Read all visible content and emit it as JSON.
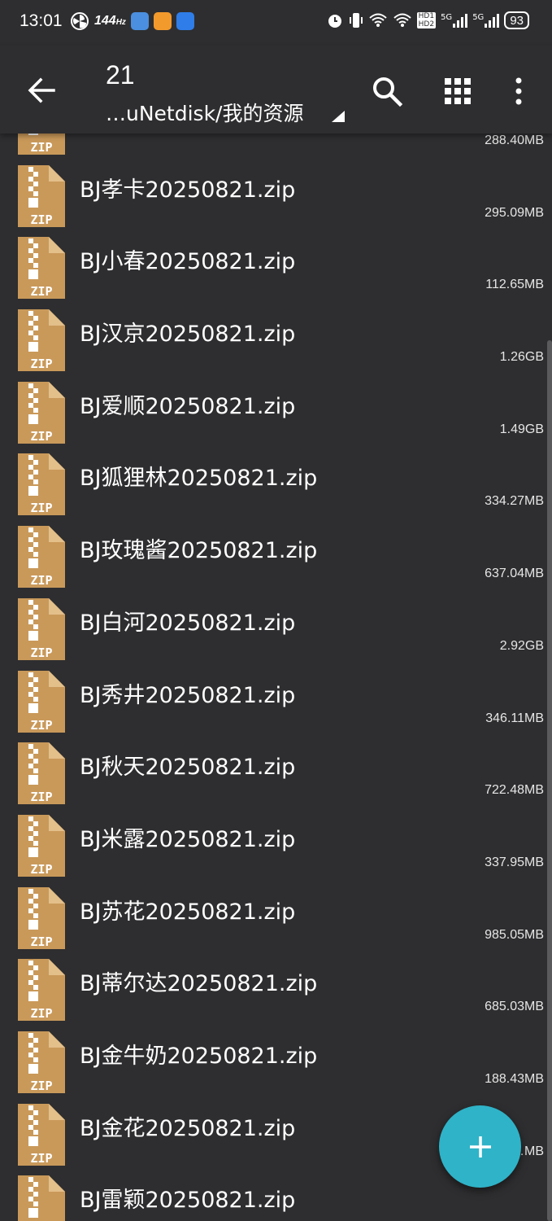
{
  "status_bar": {
    "time": "13:01",
    "refresh_rate": "144",
    "refresh_unit": "Hz",
    "battery": "93",
    "network": "5G",
    "hd1": "HD1",
    "hd2": "HD2"
  },
  "app_bar": {
    "title": "21",
    "subtitle": "…uNetdisk/我的资源",
    "back_icon": "arrow-left",
    "search_icon": "magnifier",
    "grid_icon": "grid-view",
    "more_icon": "vertical-dots"
  },
  "files": [
    {
      "name": "",
      "size": "288.40MB"
    },
    {
      "name": "BJ孝卡20250821.zip",
      "size": "295.09MB"
    },
    {
      "name": "BJ小春20250821.zip",
      "size": "112.65MB"
    },
    {
      "name": "BJ汉京20250821.zip",
      "size": "1.26GB"
    },
    {
      "name": "BJ爱顺20250821.zip",
      "size": "1.49GB"
    },
    {
      "name": "BJ狐狸林20250821.zip",
      "size": "334.27MB"
    },
    {
      "name": "BJ玫瑰酱20250821.zip",
      "size": "637.04MB"
    },
    {
      "name": "BJ白河20250821.zip",
      "size": "2.92GB"
    },
    {
      "name": "BJ秀井20250821.zip",
      "size": "346.11MB"
    },
    {
      "name": "BJ秋天20250821.zip",
      "size": "722.48MB"
    },
    {
      "name": "BJ米露20250821.zip",
      "size": "337.95MB"
    },
    {
      "name": "BJ苏花20250821.zip",
      "size": "985.05MB"
    },
    {
      "name": "BJ蒂尔达20250821.zip",
      "size": "685.03MB"
    },
    {
      "name": "BJ金牛奶20250821.zip",
      "size": "188.43MB"
    },
    {
      "name": "BJ金花20250821.zip",
      "size": "…MB"
    },
    {
      "name": "BJ雷颖20250821.zip",
      "size": ""
    }
  ],
  "file_icon_label": "ZIP",
  "fab": {
    "icon": "plus"
  },
  "colors": {
    "background": "#2e2e30",
    "zip_icon": "#c9995a",
    "fab": "#2fb3c8"
  }
}
